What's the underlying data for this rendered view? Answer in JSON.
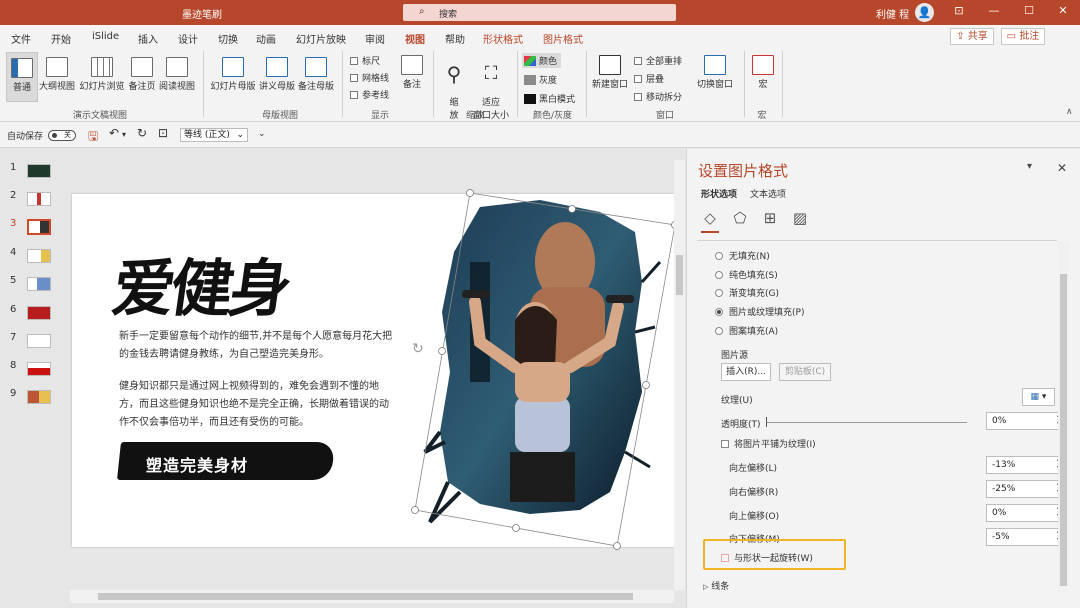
{
  "titlebar": {
    "app_title": "墨迹笔刷",
    "search_placeholder": "搜索",
    "user_name": "利健 程",
    "win_controls": [
      "⊡",
      "—",
      "☐",
      "✕"
    ]
  },
  "tabs": [
    "文件",
    "开始",
    "iSlide",
    "插入",
    "设计",
    "切换",
    "动画",
    "幻灯片放映",
    "审阅",
    "视图",
    "帮助",
    "形状格式",
    "图片格式"
  ],
  "active_tab": "视图",
  "share_label": "共享",
  "comment_label": "批注",
  "ribbon": {
    "presentation_views": {
      "label": "演示文稿视图",
      "buttons": [
        "普通",
        "大纲视图",
        "幻灯片浏览",
        "备注页",
        "阅读视图"
      ]
    },
    "master_views": {
      "label": "母版视图",
      "buttons": [
        "幻灯片母版",
        "讲义母版",
        "备注母版"
      ]
    },
    "show": {
      "label": "显示",
      "checks": [
        "标尺",
        "网格线",
        "参考线"
      ],
      "notes_button": "备注"
    },
    "zoom": {
      "label": "缩放",
      "zoom_button": "缩\n放",
      "fit_button": "适应\n窗口大小"
    },
    "color": {
      "label": "颜色/灰度",
      "items": [
        "颜色",
        "灰度",
        "黑白模式"
      ]
    },
    "window": {
      "label": "窗口",
      "new_window": "新建窗口",
      "items": [
        "全部重排",
        "层叠",
        "移动拆分"
      ],
      "switch": "切换窗口"
    },
    "macro": {
      "label": "宏",
      "button": "宏"
    }
  },
  "qat": {
    "autosave_label": "自动保存",
    "autosave_state": "关",
    "font_value": "等线 (正文)"
  },
  "thumbnails": [
    "1",
    "2",
    "3",
    "4",
    "5",
    "6",
    "7",
    "8",
    "9"
  ],
  "active_slide": 3,
  "slide": {
    "title": "爱健身",
    "para1": "新手一定要留意每个动作的细节,并不是每个人愿意每月花大把的金钱去聘请健身教练，为自己塑造完美身形。",
    "para2": "健身知识都只是通过网上视频得到的，难免会遇到不懂的地方，而且这些健身知识也绝不是完全正确，长期做着错误的动作不仅会事倍功半，而且还有受伤的可能。",
    "banner": "塑造完美身材"
  },
  "pane": {
    "title": "设置图片格式",
    "subtabs": [
      "形状选项",
      "文本选项"
    ],
    "fill_options": [
      "无填充(N)",
      "纯色填充(S)",
      "渐变填充(G)",
      "图片或纹理填充(P)",
      "图案填充(A)"
    ],
    "selected_fill": 3,
    "picture_source_label": "图片源",
    "insert_button": "插入(R)...",
    "clipboard_button": "剪贴板(C)",
    "texture_label": "纹理(U)",
    "transparency_label": "透明度(T)",
    "transparency_value": "0%",
    "tile_label": "将图片平铺为纹理(I)",
    "offsets": [
      {
        "label": "向左偏移(L)",
        "value": "-13%"
      },
      {
        "label": "向右偏移(R)",
        "value": "-25%"
      },
      {
        "label": "向上偏移(O)",
        "value": "0%"
      },
      {
        "label": "向下偏移(M)",
        "value": "-5%"
      }
    ],
    "rotate_label": "与形状一起旋转(W)",
    "line_label": "线条"
  },
  "colors": {
    "accent": "#b7472a",
    "highlight": "#f0b323"
  }
}
